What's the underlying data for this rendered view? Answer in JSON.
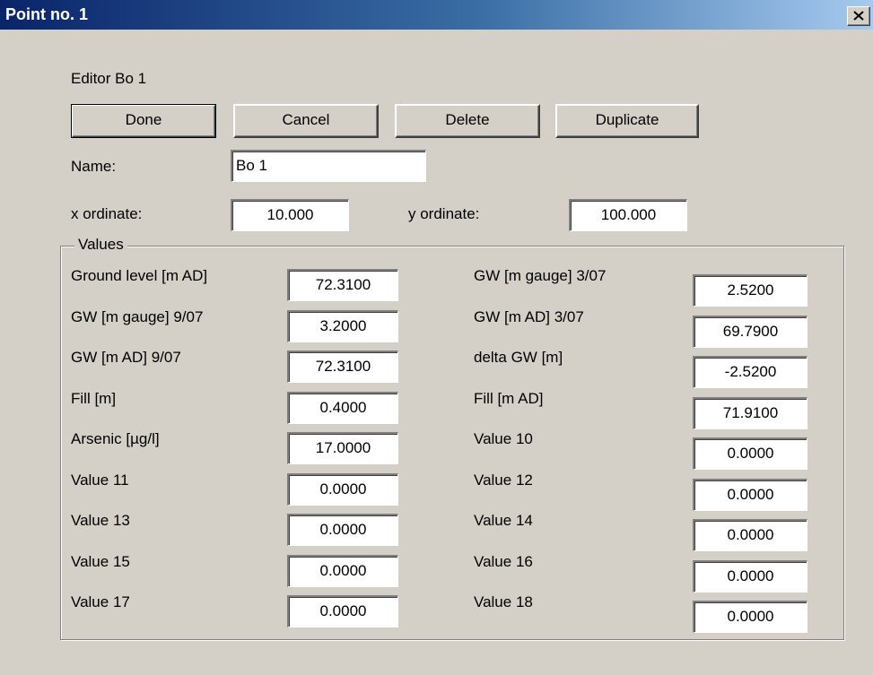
{
  "window": {
    "title": "Point no. 1"
  },
  "editor_label": "Editor Bo 1",
  "buttons": {
    "done": "Done",
    "cancel": "Cancel",
    "delete": "Delete",
    "duplicate": "Duplicate"
  },
  "name": {
    "label": "Name:",
    "value": "Bo 1"
  },
  "x_ordinate": {
    "label": "x ordinate:",
    "value": "10.000"
  },
  "y_ordinate": {
    "label": "y ordinate:",
    "value": "100.000"
  },
  "values_group": {
    "title": "Values",
    "rows": [
      {
        "left_label": "Ground level [m AD]",
        "left_value": "72.3100",
        "right_label": "GW [m gauge] 3/07",
        "right_value": "2.5200"
      },
      {
        "left_label": "GW [m gauge] 9/07",
        "left_value": "3.2000",
        "right_label": "GW [m AD] 3/07",
        "right_value": "69.7900"
      },
      {
        "left_label": "GW [m AD] 9/07",
        "left_value": "72.3100",
        "right_label": "delta GW [m]",
        "right_value": "-2.5200"
      },
      {
        "left_label": "Fill [m]",
        "left_value": "0.4000",
        "right_label": "Fill [m AD]",
        "right_value": "71.9100"
      },
      {
        "left_label": "Arsenic [µg/l]",
        "left_value": "17.0000",
        "right_label": "Value 10",
        "right_value": "0.0000"
      },
      {
        "left_label": "Value 11",
        "left_value": "0.0000",
        "right_label": "Value 12",
        "right_value": "0.0000"
      },
      {
        "left_label": "Value 13",
        "left_value": "0.0000",
        "right_label": "Value 14",
        "right_value": "0.0000"
      },
      {
        "left_label": "Value 15",
        "left_value": "0.0000",
        "right_label": "Value 16",
        "right_value": "0.0000"
      },
      {
        "left_label": "Value 17",
        "left_value": "0.0000",
        "right_label": "Value 18",
        "right_value": "0.0000"
      }
    ]
  }
}
